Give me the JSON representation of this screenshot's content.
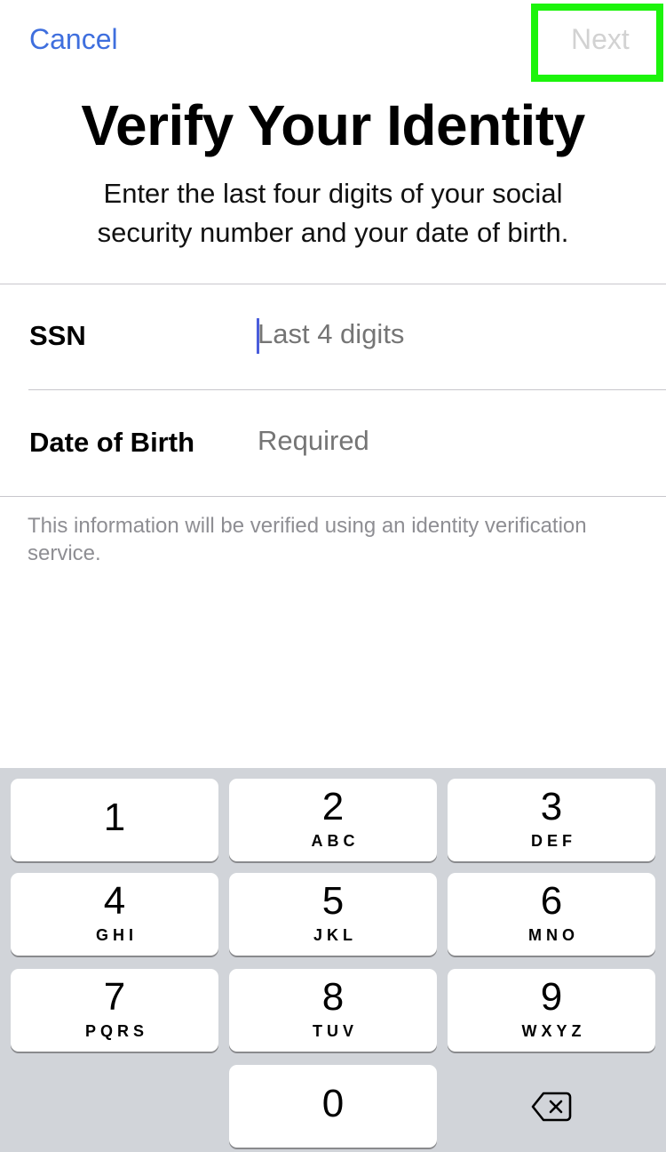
{
  "nav": {
    "cancel_label": "Cancel",
    "next_label": "Next",
    "highlight_color": "#1cf40b",
    "accent_color": "#3f6fde"
  },
  "header": {
    "title": "Verify Your Identity",
    "subtitle_line1": "Enter the last four digits of your social",
    "subtitle_line2": "security number and your date of birth."
  },
  "form": {
    "ssn": {
      "label": "SSN",
      "value": "",
      "placeholder": "Last 4 digits"
    },
    "dob": {
      "label": "Date of Birth",
      "value": "",
      "placeholder": "Required"
    },
    "footnote": "This information will be verified using an identity verification service."
  },
  "keypad": {
    "keys": [
      {
        "num": "1",
        "letters": ""
      },
      {
        "num": "2",
        "letters": "ABC"
      },
      {
        "num": "3",
        "letters": "DEF"
      },
      {
        "num": "4",
        "letters": "GHI"
      },
      {
        "num": "5",
        "letters": "JKL"
      },
      {
        "num": "6",
        "letters": "MNO"
      },
      {
        "num": "7",
        "letters": "PQRS"
      },
      {
        "num": "8",
        "letters": "TUV"
      },
      {
        "num": "9",
        "letters": "WXYZ"
      },
      {
        "num": "0",
        "letters": ""
      }
    ],
    "delete_icon": "backspace-icon"
  }
}
